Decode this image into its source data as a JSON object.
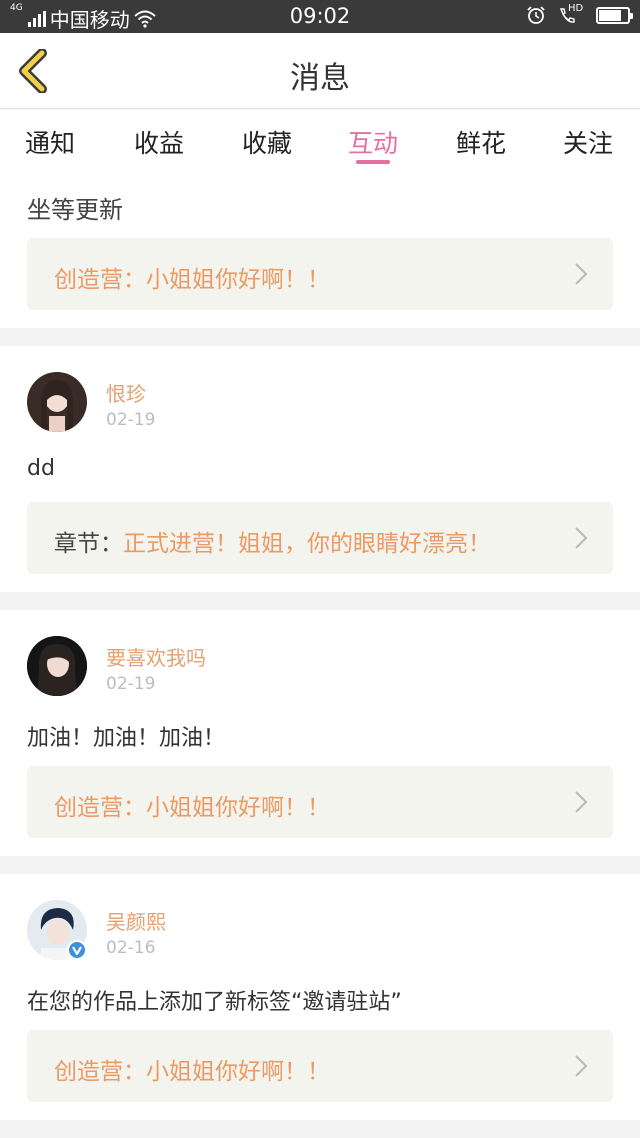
{
  "status_bar": {
    "network": "4G",
    "carrier": "中国移动",
    "time": "09:02",
    "hd": "HD",
    "battery_level": 0.85
  },
  "nav": {
    "title": "消息"
  },
  "tabs": {
    "items": [
      "通知",
      "收益",
      "收藏",
      "互动",
      "鲜花",
      "关注"
    ],
    "active": "互动",
    "active_color": "#e66ea0"
  },
  "partial_card": {
    "text": "坐等更新",
    "ref": {
      "prefix": "",
      "link": "创造营：小姐姐你好啊！！"
    }
  },
  "messages": [
    {
      "user": "恨珍",
      "date": "02-19",
      "content": "dd",
      "ref": {
        "prefix": "章节：",
        "link": "正式进营！姐姐，你的眼睛好漂亮！"
      },
      "avatar": "user-avatar"
    },
    {
      "user": "要喜欢我吗",
      "date": "02-19",
      "content": "加油！加油！加油！",
      "ref": {
        "prefix": "",
        "link": "创造营：小姐姐你好啊！！"
      },
      "avatar": "user-avatar"
    },
    {
      "user": "吴颜熙",
      "date": "02-16",
      "content": "在您的作品上添加了新标签“邀请驻站”",
      "ref": {
        "prefix": "",
        "link": "创造营：小姐姐你好啊！！"
      },
      "avatar": "user-avatar",
      "verified": true
    }
  ],
  "colors": {
    "link": "#ec9a63",
    "username": "#e5a070",
    "back_chevron": "#f2d04a"
  }
}
